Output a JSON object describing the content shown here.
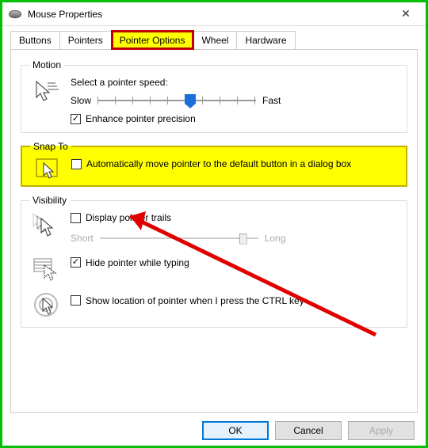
{
  "window": {
    "title": "Mouse Properties"
  },
  "tabs": {
    "t0": "Buttons",
    "t1": "Pointers",
    "t2": "Pointer Options",
    "t3": "Wheel",
    "t4": "Hardware"
  },
  "motion": {
    "legend": "Motion",
    "speed_label": "Select a pointer speed:",
    "slow": "Slow",
    "fast": "Fast",
    "enhance": "Enhance pointer precision"
  },
  "snapto": {
    "legend": "Snap To",
    "auto": "Automatically move pointer to the default button in a dialog box"
  },
  "visibility": {
    "legend": "Visibility",
    "trails": "Display pointer trails",
    "short": "Short",
    "long": "Long",
    "hide": "Hide pointer while typing",
    "ctrl": "Show location of pointer when I press the CTRL key"
  },
  "buttons": {
    "ok": "OK",
    "cancel": "Cancel",
    "apply": "Apply"
  }
}
